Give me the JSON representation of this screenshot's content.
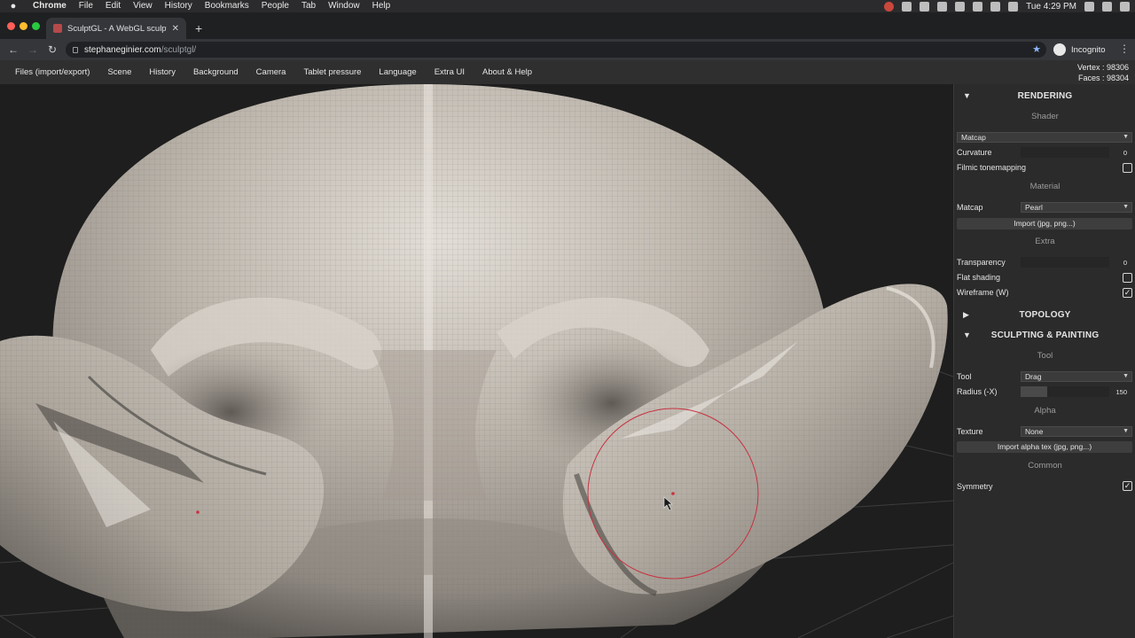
{
  "mac_menubar": {
    "apple_icon": "apple-icon",
    "app_name": "Chrome",
    "items": [
      "File",
      "Edit",
      "View",
      "History",
      "Bookmarks",
      "People",
      "Tab",
      "Window",
      "Help"
    ],
    "clock": "Tue 4:29 PM"
  },
  "browser": {
    "tab_title": "SculptGL - A WebGL sculpting",
    "url_host": "stephaneginier.com",
    "url_path": "/sculptgl/",
    "profile_label": "Incognito"
  },
  "app_menu": {
    "items": [
      "Files (import/export)",
      "Scene",
      "History",
      "Background",
      "Camera",
      "Tablet pressure",
      "Language",
      "Extra UI",
      "About & Help"
    ],
    "vertex": "Vertex : 98306",
    "faces": "Faces : 98304"
  },
  "panel": {
    "rendering": {
      "title": "RENDERING",
      "shader_title": "Shader",
      "shader_value": "Matcap",
      "curvature_label": "Curvature",
      "curvature_value": "0",
      "curvature_fraction": 0,
      "filmic_label": "Filmic tonemapping",
      "filmic_checked": false,
      "material_title": "Material",
      "matcap_label": "Matcap",
      "matcap_value": "Pearl",
      "import_label": "Import (jpg, png...)",
      "extra_title": "Extra",
      "transparency_label": "Transparency",
      "transparency_value": "0",
      "transparency_fraction": 0,
      "flat_label": "Flat shading",
      "flat_checked": false,
      "wireframe_label": "Wireframe (W)",
      "wireframe_checked": true
    },
    "topology": {
      "title": "TOPOLOGY"
    },
    "sculpting": {
      "title": "SCULPTING & PAINTING",
      "tool_title": "Tool",
      "tool_label": "Tool",
      "tool_value": "Drag",
      "radius_label": "Radius (-X)",
      "radius_value": "150",
      "radius_fraction": 0.3,
      "alpha_title": "Alpha",
      "texture_label": "Texture",
      "texture_value": "None",
      "import_alpha_label": "Import alpha tex (jpg, png...)",
      "common_title": "Common",
      "symmetry_label": "Symmetry",
      "symmetry_checked": true
    }
  },
  "colors": {
    "panel_bg": "#2b2b2b",
    "menu_bg": "#2f2f2f",
    "viewport_bg": "#1e1e1e",
    "brush_circle": "#c8313f",
    "mesh": "#b8b1a8"
  }
}
